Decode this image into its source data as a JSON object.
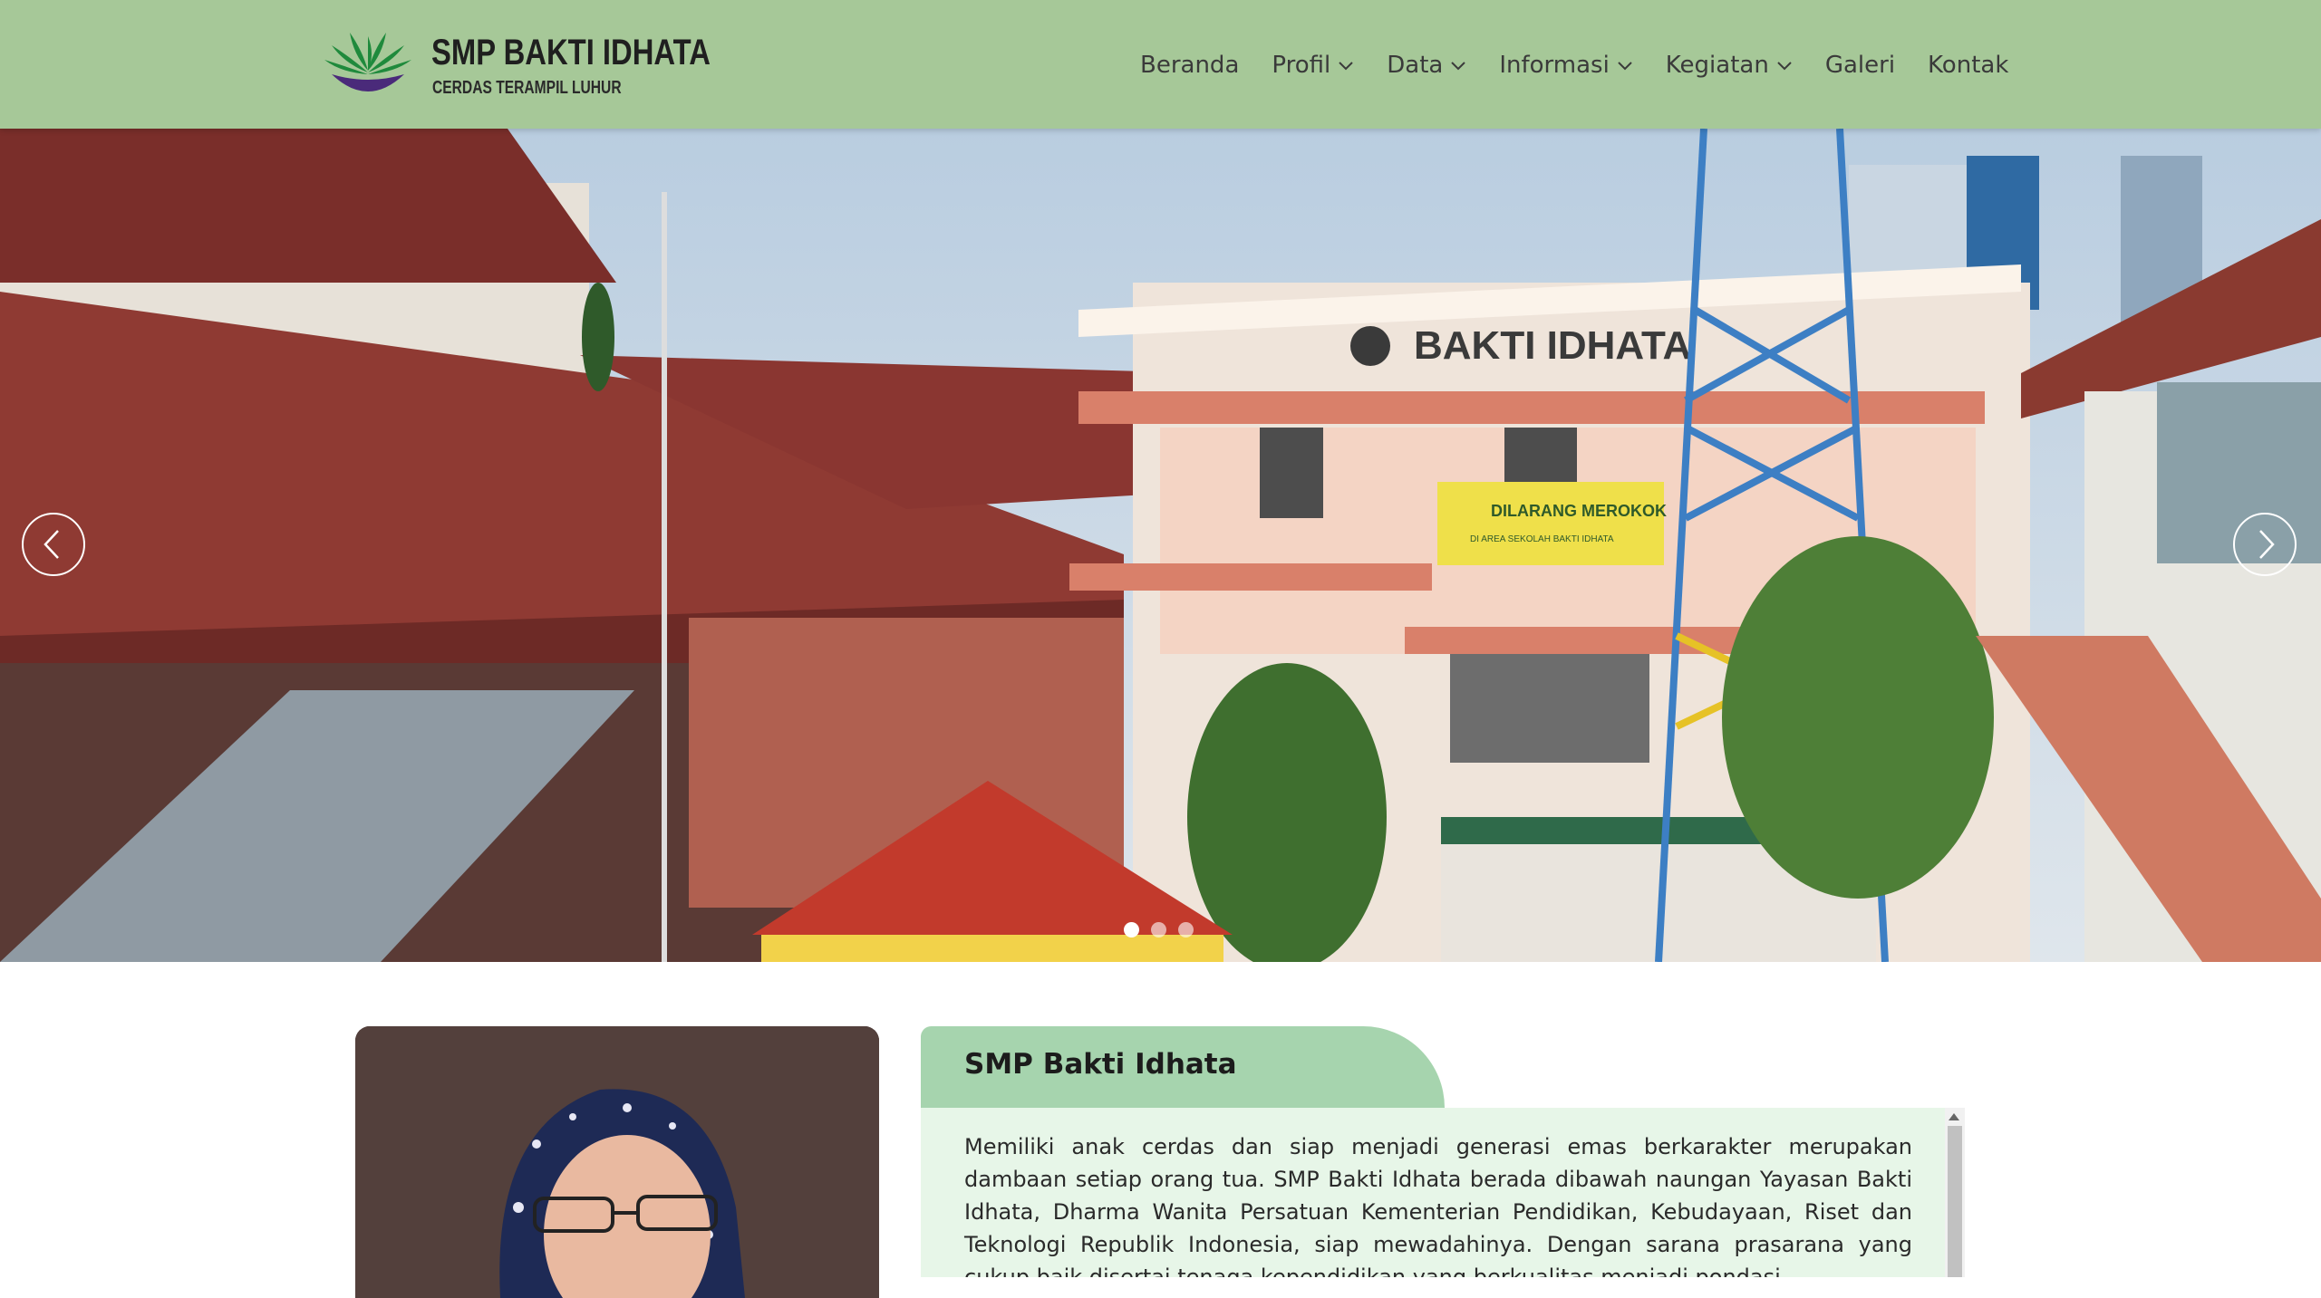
{
  "header": {
    "brand_name": "SMP BAKTI IDHATA",
    "brand_tagline": "CERDAS TERAMPIL LUHUR",
    "logo_icon": "school-logo-icon"
  },
  "nav": {
    "items": [
      {
        "label": "Beranda",
        "dropdown": false
      },
      {
        "label": "Profil",
        "dropdown": true
      },
      {
        "label": "Data",
        "dropdown": true
      },
      {
        "label": "Informasi",
        "dropdown": true
      },
      {
        "label": "Kegiatan",
        "dropdown": true
      },
      {
        "label": "Galeri",
        "dropdown": false
      },
      {
        "label": "Kontak",
        "dropdown": false
      }
    ]
  },
  "hero": {
    "sign_building": "BAKTI IDHATA",
    "sign_banner_line1": "DILARANG MEROKOK",
    "sign_banner_line2": "DI AREA SEKOLAH BAKTI IDHATA",
    "prev_icon": "chevron-left-icon",
    "next_icon": "chevron-right-icon",
    "slide_count": 3,
    "active_slide": 1
  },
  "about": {
    "title": "SMP Bakti Idhata",
    "body": "Memiliki anak cerdas dan siap menjadi generasi emas berkarakter merupakan dambaan setiap orang tua. SMP Bakti Idhata berada dibawah naungan Yayasan Bakti Idhata, Dharma Wanita Persatuan Kementerian Pendidikan, Kebudayaan, Riset dan Teknologi Republik Indonesia, siap mewadahinya. Dengan sarana prasarana yang cukup baik disertai tenaga kependidikan yang berkualitas menjadi pondasi"
  },
  "colors": {
    "header_bg": "#a6c898",
    "about_tab_bg": "#a6d4ae",
    "about_body_bg": "#e7f6e8",
    "logo_green": "#1f8a3c",
    "logo_purple": "#4a2a7a"
  }
}
